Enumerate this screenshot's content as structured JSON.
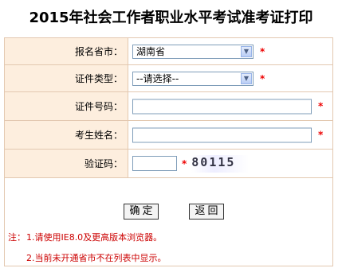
{
  "page": {
    "title": "2015年社会工作者职业水平考试准考证打印"
  },
  "form": {
    "province": {
      "label": "报名省市：",
      "value": "湖南省"
    },
    "id_type": {
      "label": "证件类型：",
      "value": "--请选择--"
    },
    "id_number": {
      "label": "证件号码：",
      "value": ""
    },
    "name": {
      "label": "考生姓名：",
      "value": ""
    },
    "captcha": {
      "label": "验证码：",
      "value": "",
      "image_text": "80115"
    },
    "required_mark": "*"
  },
  "buttons": {
    "confirm": "确定",
    "back": "返回"
  },
  "notes": {
    "prefix": "注：",
    "line1": "1.请使用IE8.0及更高版本浏览器。",
    "line2": "2.当前未开通省市不在列表中显示。"
  },
  "colors": {
    "label_bg": "#fdeede",
    "border": "#e3c8b0",
    "required": "#e00000",
    "note": "#cc0000"
  }
}
